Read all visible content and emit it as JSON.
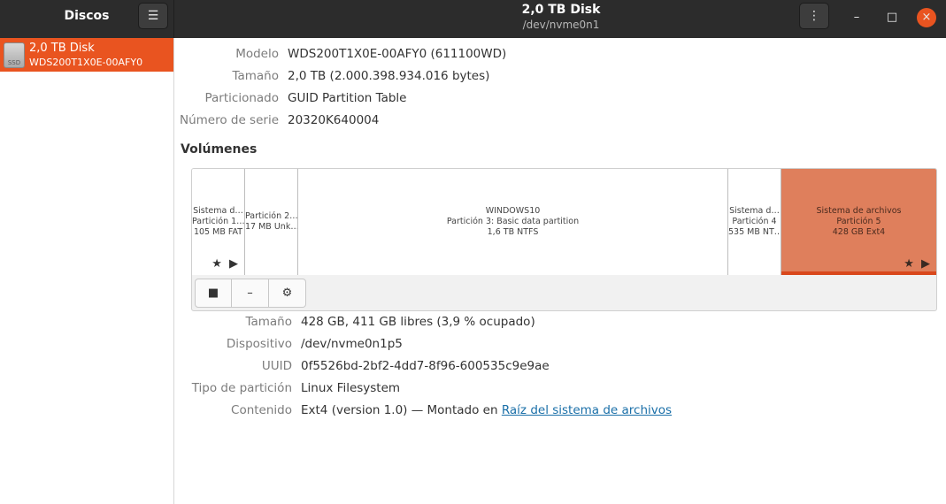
{
  "header": {
    "app_title": "Discos",
    "menu_icon": "hamburger-icon",
    "disk_title": "2,0 TB Disk",
    "disk_device": "/dev/nvme0n1",
    "kebab_icon": "vertical-dots-icon",
    "window_controls": {
      "minimize": "–",
      "maximize": "□",
      "close": "×"
    }
  },
  "sidebar": {
    "disk": {
      "icon_label": "SSD",
      "name": "2,0 TB Disk",
      "subtitle": "WDS200T1X0E-00AFY0"
    }
  },
  "details": {
    "model_label": "Modelo",
    "model_value": "WDS200T1X0E-00AFY0 (611100WD)",
    "size_label": "Tamaño",
    "size_value": "2,0 TB (2.000.398.934.016 bytes)",
    "partitioning_label": "Particionado",
    "partitioning_value": "GUID Partition Table",
    "serial_label": "Número de serie",
    "serial_value": "20320K640004"
  },
  "volumes": {
    "section_title": "Volúmenes",
    "partitions": [
      {
        "line1": "Sistema d…",
        "line2": "Partición 1…",
        "line3": "105 MB FAT",
        "marks": "★ ▶"
      },
      {
        "line1": "Partición 2…",
        "line2": "17 MB Unk…",
        "line3": "",
        "marks": ""
      },
      {
        "line1": "WINDOWS10",
        "line2": "Partición 3: Basic data partition",
        "line3": "1,6 TB NTFS",
        "marks": ""
      },
      {
        "line1": "Sistema d…",
        "line2": "Partición 4",
        "line3": "535 MB NT…",
        "marks": ""
      },
      {
        "line1": "Sistema de archivos",
        "line2": "Partición 5",
        "line3": "428 GB Ext4",
        "marks": "★ ▶"
      }
    ],
    "toolbar": {
      "stop": "■",
      "remove": "–",
      "settings": "⚙"
    }
  },
  "volume_details": {
    "size_label": "Tamaño",
    "size_value": "428 GB, 411 GB libres (3,9 % ocupado)",
    "device_label": "Dispositivo",
    "device_value": "/dev/nvme0n1p5",
    "uuid_label": "UUID",
    "uuid_value": "0f5526bd-2bf2-4dd7-8f96-600535c9e9ae",
    "type_label": "Tipo de partición",
    "type_value": "Linux Filesystem",
    "content_label": "Contenido",
    "content_value": "Ext4 (version 1.0) — Montado en ",
    "content_link": "Raíz del sistema de archivos"
  },
  "colors": {
    "accent": "#e95420",
    "selected_partition": "#df7f5c",
    "header": "#2c2c2c",
    "link": "#1a6fa8"
  }
}
